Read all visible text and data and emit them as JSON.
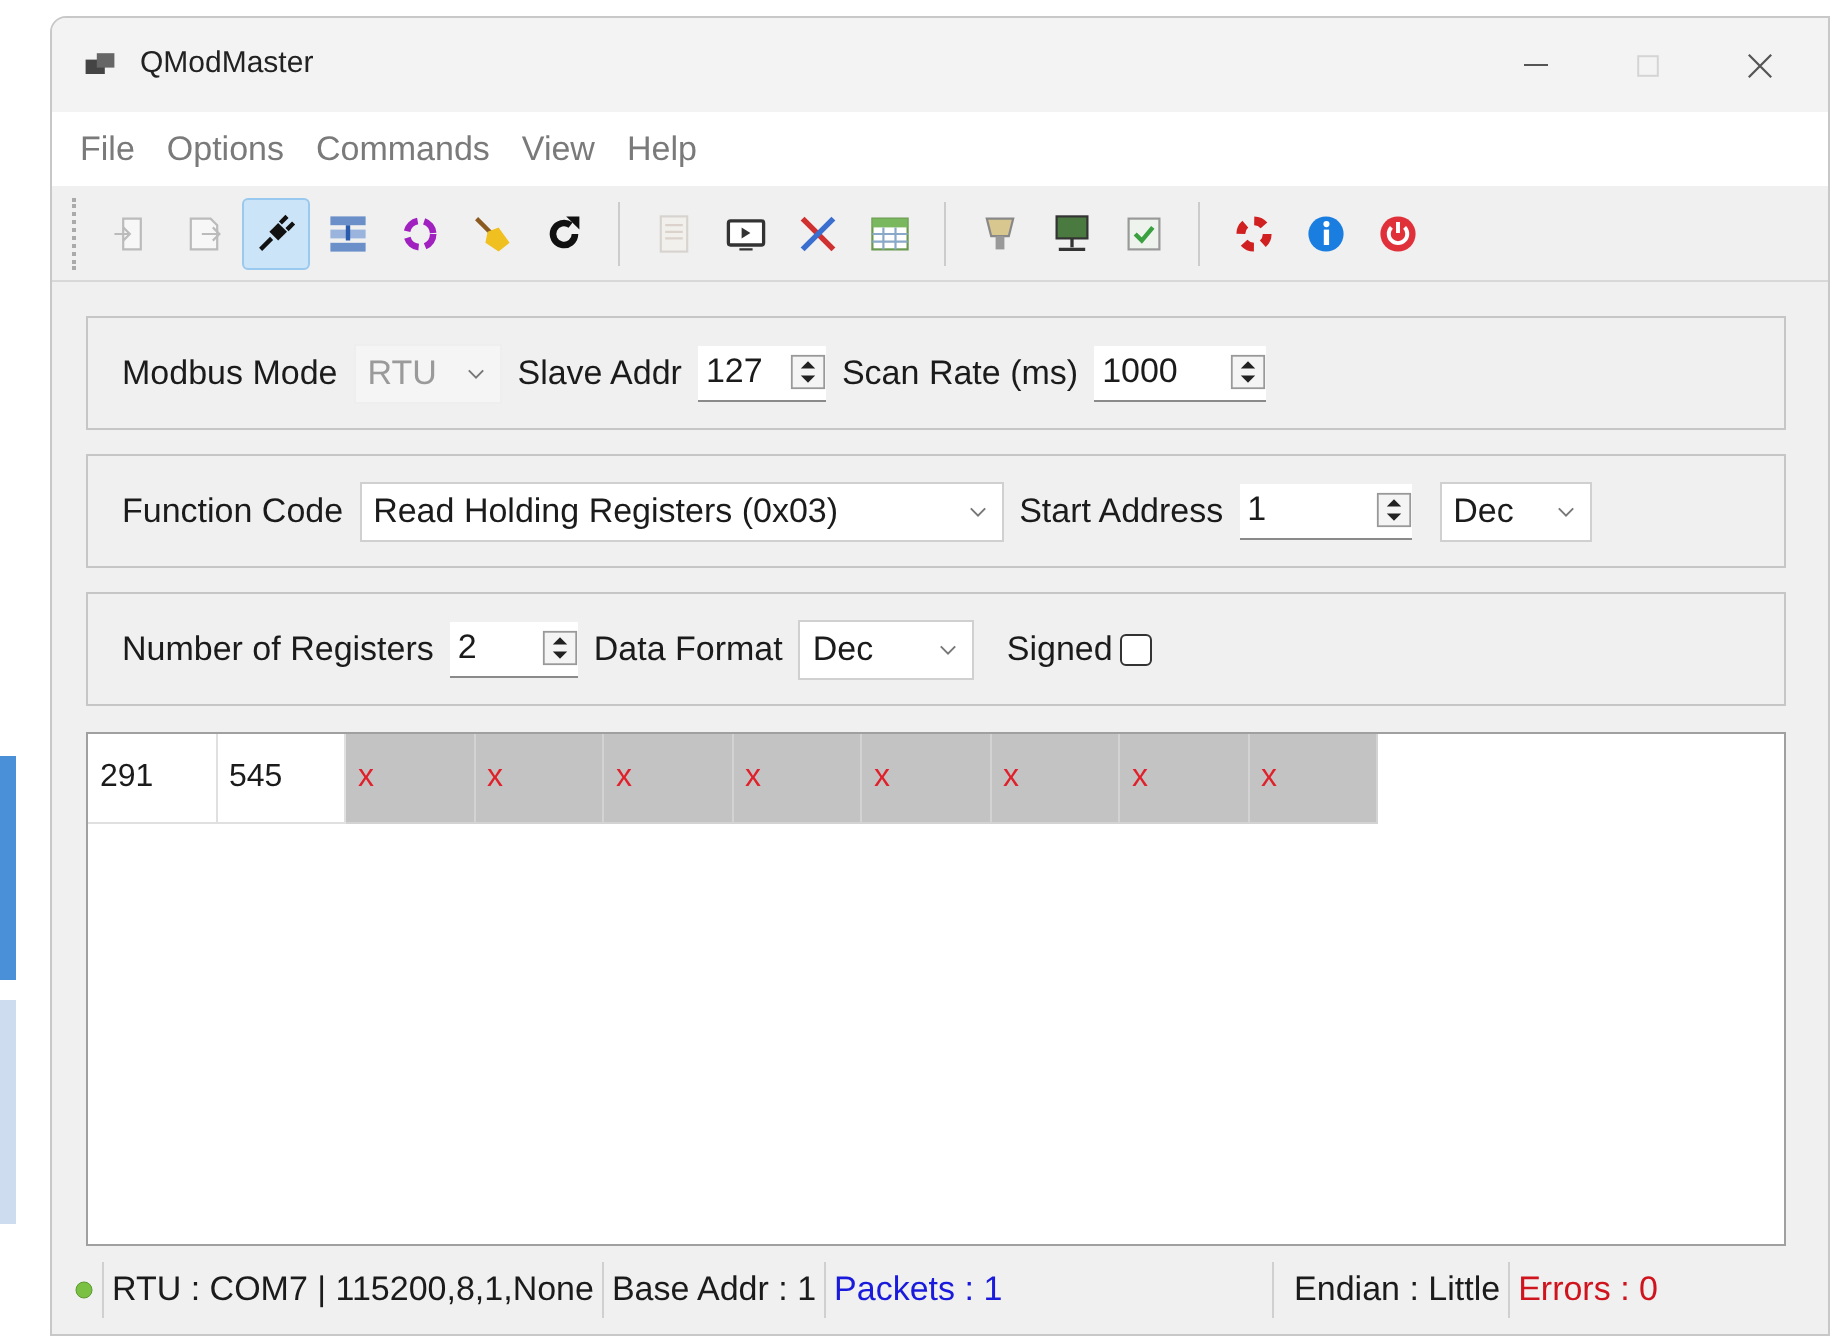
{
  "window": {
    "title": "QModMaster"
  },
  "menu": [
    "File",
    "Options",
    "Commands",
    "View",
    "Help"
  ],
  "toolbar": [
    {
      "kind": "button",
      "disabled": true,
      "selected": false
    },
    {
      "kind": "button",
      "disabled": true,
      "selected": false
    },
    {
      "kind": "button",
      "disabled": false,
      "selected": true
    },
    {
      "kind": "button",
      "disabled": false,
      "selected": false
    },
    {
      "kind": "button",
      "disabled": false,
      "selected": false
    },
    {
      "kind": "button",
      "disabled": false,
      "selected": false
    },
    {
      "kind": "button",
      "disabled": false,
      "selected": false
    },
    {
      "kind": "separator"
    },
    {
      "kind": "button",
      "disabled": true,
      "selected": false
    },
    {
      "kind": "button",
      "disabled": false,
      "selected": false
    },
    {
      "kind": "button",
      "disabled": false,
      "selected": false
    },
    {
      "kind": "button",
      "disabled": false,
      "selected": false
    },
    {
      "kind": "separator"
    },
    {
      "kind": "button",
      "disabled": false,
      "selected": false
    },
    {
      "kind": "button",
      "disabled": false,
      "selected": false
    },
    {
      "kind": "button",
      "disabled": false,
      "selected": false
    },
    {
      "kind": "separator"
    },
    {
      "kind": "button",
      "disabled": false,
      "selected": false
    },
    {
      "kind": "button",
      "disabled": false,
      "selected": false
    },
    {
      "kind": "button",
      "disabled": false,
      "selected": false
    }
  ],
  "mode_bar": {
    "modbus_mode_label": "Modbus Mode",
    "modbus_mode": {
      "value": "RTU",
      "disabled": true
    },
    "slave_addr_label": "Slave Addr",
    "slave_addr": "127",
    "scan_rate_label": "Scan Rate (ms)",
    "scan_rate": "1000"
  },
  "function_bar": {
    "function_code_label": "Function Code",
    "function_code": "Read Holding Registers (0x03)",
    "start_address_label": "Start Address",
    "start_address": "1",
    "address_format": "Dec"
  },
  "registers_bar": {
    "number_label": "Number of Registers",
    "number": "2",
    "data_format_label": "Data Format",
    "data_format": "Dec",
    "signed_label": "Signed",
    "signed_checked": false
  },
  "table": {
    "cells": [
      {
        "text": "291",
        "valid": true
      },
      {
        "text": "545",
        "valid": true
      },
      {
        "text": "x",
        "valid": false
      },
      {
        "text": "x",
        "valid": false
      },
      {
        "text": "x",
        "valid": false
      },
      {
        "text": "x",
        "valid": false
      },
      {
        "text": "x",
        "valid": false
      },
      {
        "text": "x",
        "valid": false
      },
      {
        "text": "x",
        "valid": false
      },
      {
        "text": "x",
        "valid": false
      }
    ]
  },
  "status_bar": {
    "connected": true,
    "port": "RTU : COM7 | 115200,8,1,None",
    "base_addr": "Base Addr : 1",
    "packets": "Packets : 1",
    "endian": "Endian : Little",
    "errors": "Errors : 0"
  }
}
